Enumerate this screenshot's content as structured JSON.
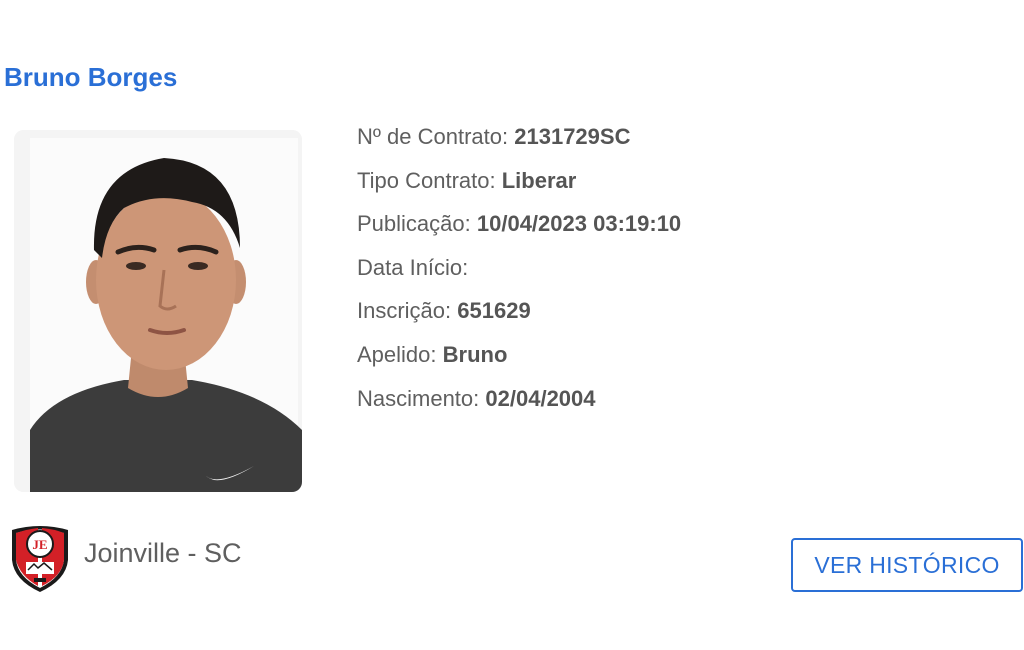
{
  "player": {
    "name": "Bruno Borges",
    "photo_icon": "player-portrait"
  },
  "details": [
    {
      "label": "Nº de Contrato:",
      "value": "2131729SC"
    },
    {
      "label": "Tipo Contrato:",
      "value": "Liberar"
    },
    {
      "label": "Publicação:",
      "value": "10/04/2023 03:19:10"
    },
    {
      "label": "Data Início:",
      "value": ""
    },
    {
      "label": "Inscrição:",
      "value": "651629"
    },
    {
      "label": "Apelido:",
      "value": "Bruno"
    },
    {
      "label": "Nascimento:",
      "value": "02/04/2004"
    }
  ],
  "club": {
    "name": "Joinville - SC",
    "logo_icon": "club-crest",
    "colors": {
      "red": "#d32027",
      "black": "#1a1a1a",
      "white": "#ffffff"
    }
  },
  "actions": {
    "history_label": "VER HISTÓRICO"
  },
  "colors": {
    "accent": "#2a6fd6",
    "text": "#5f5f5f"
  }
}
